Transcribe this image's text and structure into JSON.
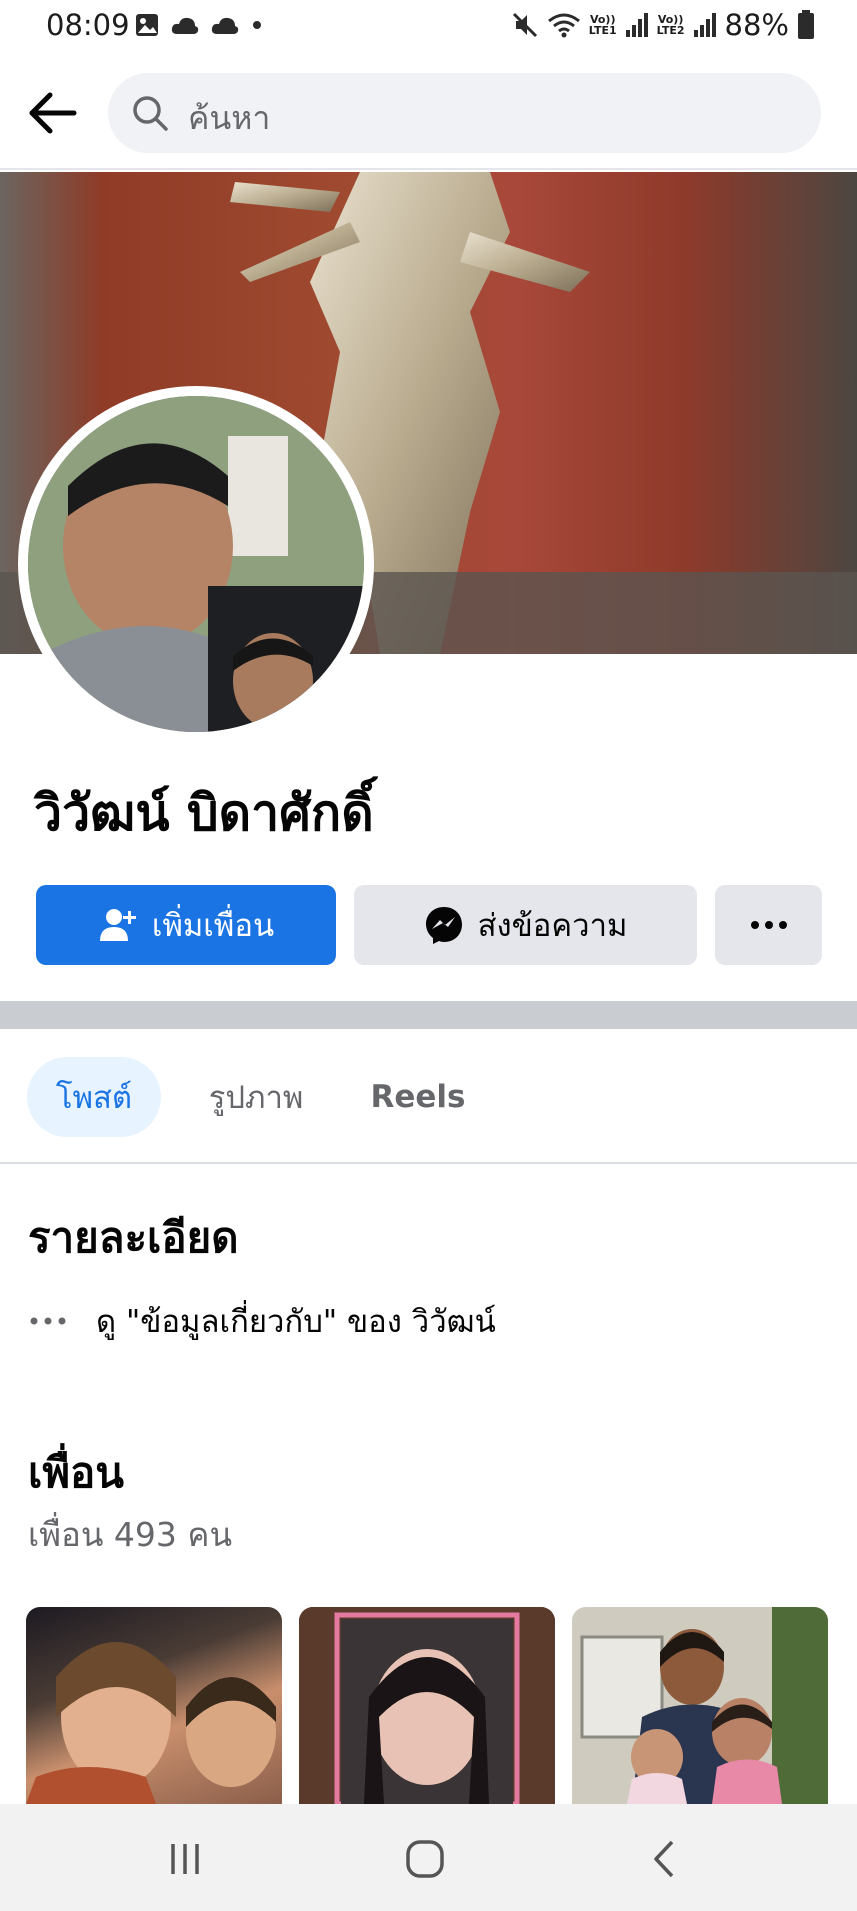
{
  "status_bar": {
    "time": "08:09",
    "battery": "88%",
    "sim1": "LTE1",
    "sim2": "LTE2",
    "volte": "Vo))",
    "icons": [
      "gallery-icon",
      "cloud-icon",
      "cloud-icon",
      "dot-icon",
      "mute-icon",
      "wifi-icon",
      "signal-icon",
      "battery-icon"
    ]
  },
  "top_bar": {
    "search_placeholder": "ค้นหา"
  },
  "profile": {
    "name": "วิวัฒน์ บิดาศักดิ์"
  },
  "actions": {
    "add_friend": "เพิ่มเพื่อน",
    "message": "ส่งข้อความ",
    "more": "···"
  },
  "tabs": [
    {
      "label": "โพสต์",
      "active": true
    },
    {
      "label": "รูปภาพ",
      "active": false
    },
    {
      "label": "Reels",
      "active": false
    }
  ],
  "details": {
    "title": "รายละเอียด",
    "about_link": "ดู \"ข้อมูลเกี่ยวกับ\" ของ วิวัฒน์"
  },
  "friends": {
    "title": "เพื่อน",
    "count_text": "เพื่อน 493 คน"
  },
  "colors": {
    "primary": "#1b74e4",
    "secondary_button": "#e4e6eb",
    "active_tab_bg": "#e7f3ff",
    "muted_text": "#65676b"
  }
}
